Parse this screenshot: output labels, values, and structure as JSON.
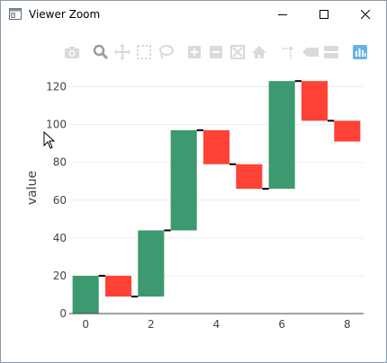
{
  "window": {
    "title": "Viewer Zoom"
  },
  "modebar": {
    "buttons": [
      {
        "name": "camera-icon"
      },
      {
        "name": "zoom-icon"
      },
      {
        "name": "pan-icon"
      },
      {
        "name": "box-select-icon"
      },
      {
        "name": "lasso-select-icon"
      },
      {
        "name": "zoom-in-icon"
      },
      {
        "name": "zoom-out-icon"
      },
      {
        "name": "autoscale-icon"
      },
      {
        "name": "home-icon"
      },
      {
        "name": "spike-lines-icon"
      },
      {
        "name": "hover-closest-icon"
      },
      {
        "name": "hover-compare-icon"
      },
      {
        "name": "plotly-logo-icon"
      }
    ]
  },
  "colors": {
    "increasing": "#3d9970",
    "decreasing": "#ff4136",
    "connector": "#000000",
    "grid": "#eeeeee",
    "modebar_icon": "#dadada",
    "modebar_active": "#9a9a9a",
    "plotly_blue": "#6ab2e4"
  },
  "chart_data": {
    "type": "waterfall",
    "ylabel": "value",
    "xlim": [
      -0.5,
      8.5
    ],
    "ylim": [
      0,
      125
    ],
    "grid": true,
    "x_ticks": [
      0,
      2,
      4,
      6,
      8
    ],
    "y_ticks": [
      0,
      20,
      40,
      60,
      80,
      100,
      120
    ],
    "x": [
      0,
      1,
      2,
      3,
      4,
      5,
      6,
      7,
      8
    ],
    "values": [
      20,
      -11,
      35,
      53,
      -18,
      -13,
      57,
      -21,
      -11
    ],
    "cumulative": [
      20,
      9,
      44,
      97,
      79,
      66,
      123,
      102,
      91
    ]
  }
}
